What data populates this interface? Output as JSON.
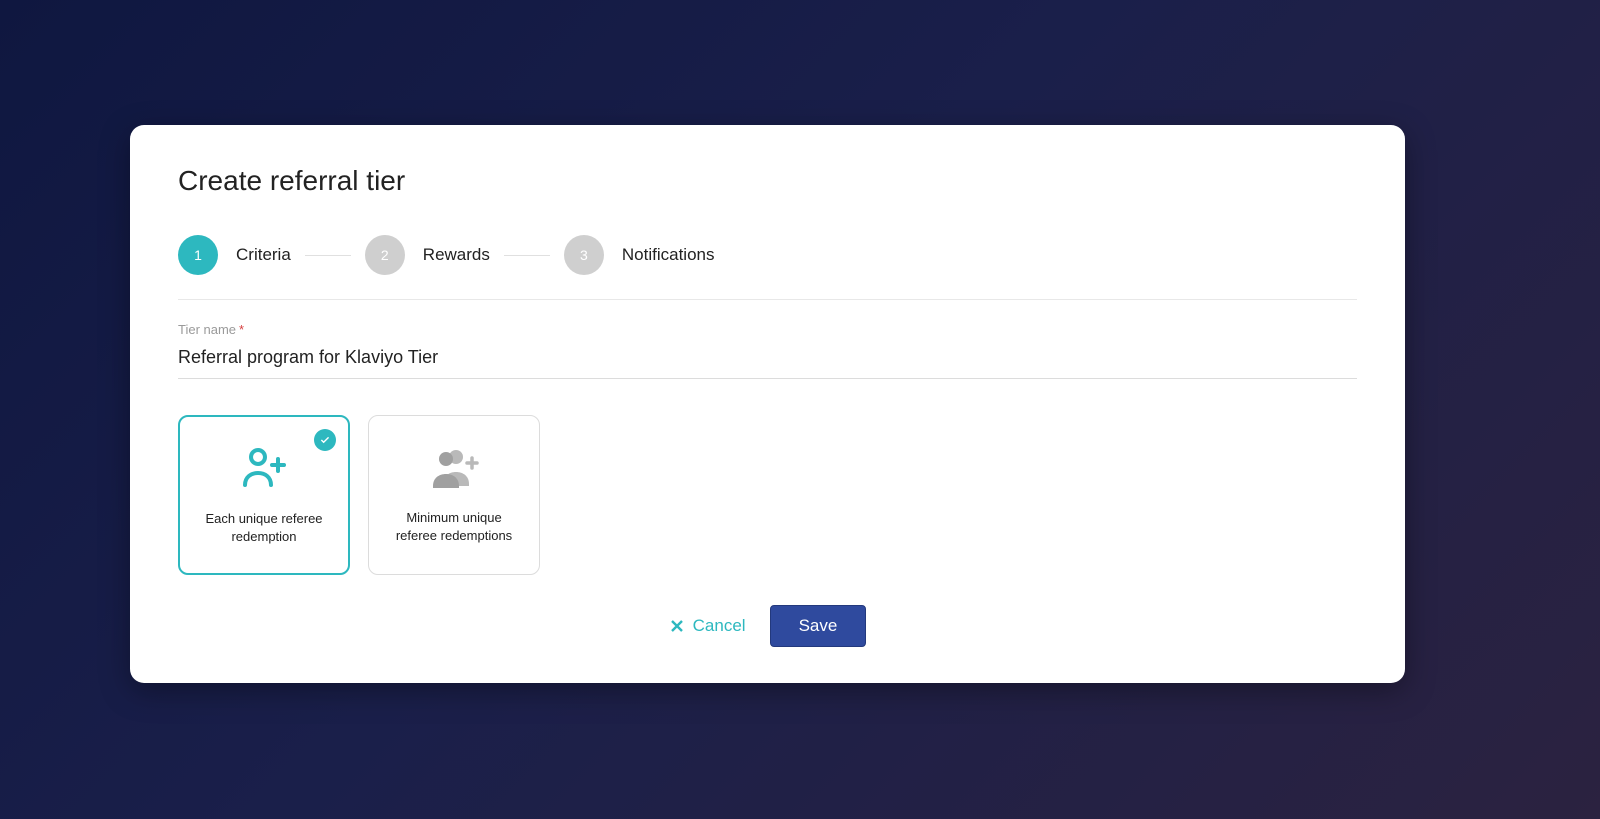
{
  "title": "Create referral tier",
  "stepper": {
    "steps": [
      {
        "num": "1",
        "label": "Criteria",
        "active": true
      },
      {
        "num": "2",
        "label": "Rewards",
        "active": false
      },
      {
        "num": "3",
        "label": "Notifications",
        "active": false
      }
    ]
  },
  "field": {
    "label": "Tier name",
    "required_mark": "*",
    "value": "Referral program for Klaviyo Tier"
  },
  "options": [
    {
      "label": "Each unique referee redemption",
      "selected": true
    },
    {
      "label": "Minimum unique referee redemptions",
      "selected": false
    }
  ],
  "actions": {
    "cancel": "Cancel",
    "save": "Save"
  },
  "colors": {
    "accent": "#2db8bf",
    "primary_button": "#2f4a9e"
  }
}
